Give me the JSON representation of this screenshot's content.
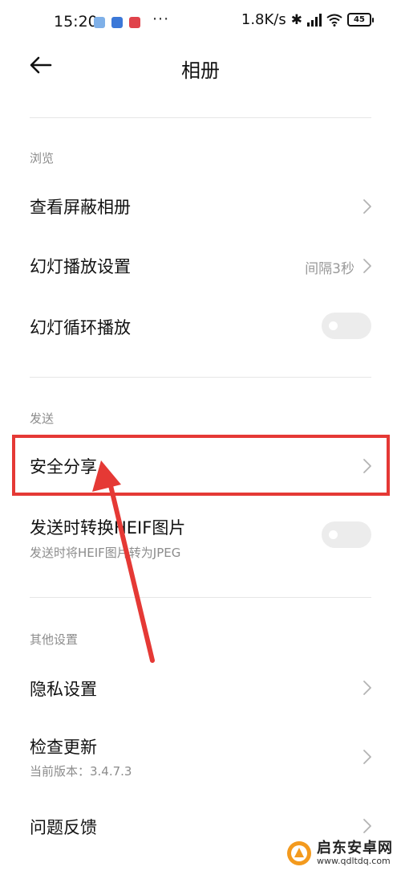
{
  "status_bar": {
    "time": "15:20",
    "more": "···",
    "network_speed": "1.8K/s",
    "bluetooth": "✱",
    "battery": "45",
    "app_colors": [
      "#7fb0e8",
      "#3b78d8",
      "#e0434b"
    ]
  },
  "header": {
    "title": "相册"
  },
  "sections": {
    "browse": {
      "label": "浏览",
      "view_hidden_albums": "查看屏蔽相册",
      "slideshow_settings": "幻灯播放设置",
      "slideshow_interval": "间隔3秒",
      "slideshow_loop": "幻灯循环播放",
      "slideshow_loop_on": false
    },
    "send": {
      "label": "发送",
      "secure_share": "安全分享",
      "convert_heif": "发送时转换HEIF图片",
      "convert_heif_desc": "发送时将HEIF图片转为JPEG",
      "convert_heif_on": false
    },
    "other": {
      "label": "其他设置",
      "privacy": "隐私设置",
      "check_update": "检查更新",
      "current_version": "当前版本：3.4.7.3",
      "feedback": "问题反馈"
    }
  },
  "annotation": {
    "color": "#e53935"
  },
  "watermark": {
    "name": "启东安卓网",
    "url": "www.qdltdq.com"
  },
  "colors": {
    "text_primary": "#111111",
    "text_secondary": "#8c8c8c",
    "toggle_off": "#ececec"
  }
}
